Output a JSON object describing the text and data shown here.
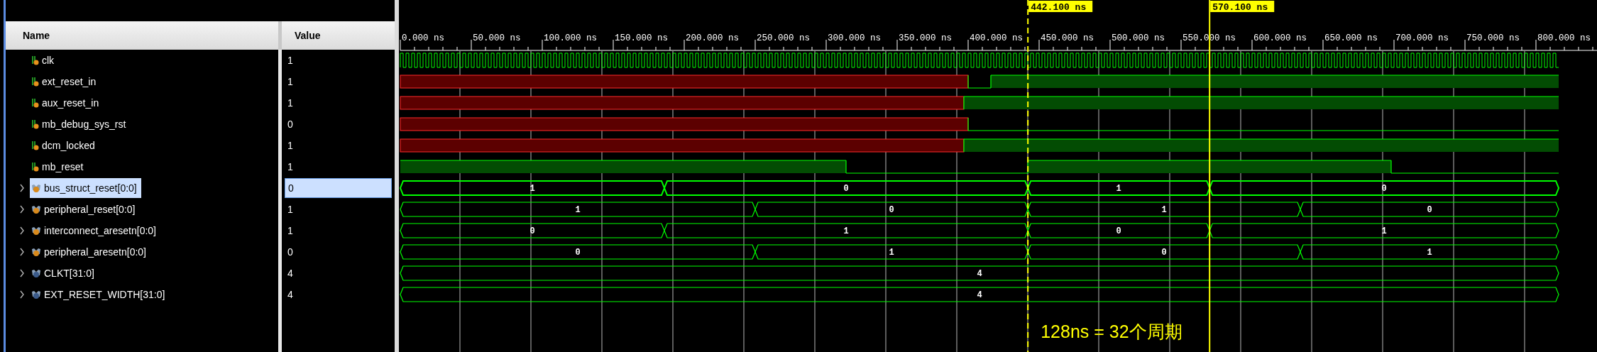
{
  "name_panel": {
    "headers": {
      "name": "Name",
      "value": "Value"
    },
    "signals": [
      {
        "name": "clk",
        "value": "1",
        "kind": "clock",
        "selected": false
      },
      {
        "name": "ext_reset_in",
        "value": "1",
        "kind": "bit",
        "selected": false
      },
      {
        "name": "aux_reset_in",
        "value": "1",
        "kind": "bit",
        "selected": false
      },
      {
        "name": "mb_debug_sys_rst",
        "value": "0",
        "kind": "bit",
        "selected": false
      },
      {
        "name": "dcm_locked",
        "value": "1",
        "kind": "bit",
        "selected": false
      },
      {
        "name": "mb_reset",
        "value": "1",
        "kind": "bit",
        "selected": false
      },
      {
        "name": "bus_struct_reset[0:0]",
        "value": "0",
        "kind": "bus",
        "selected": true,
        "wave_labels": [
          "1",
          "0",
          "1",
          "0"
        ]
      },
      {
        "name": "peripheral_reset[0:0]",
        "value": "1",
        "kind": "bus",
        "selected": false,
        "wave_labels": [
          "1",
          "0",
          "1",
          "0"
        ]
      },
      {
        "name": "interconnect_aresetn[0:0]",
        "value": "1",
        "kind": "bus",
        "selected": false,
        "wave_labels": [
          "0",
          "1",
          "0",
          "1"
        ]
      },
      {
        "name": "peripheral_aresetn[0:0]",
        "value": "0",
        "kind": "bus",
        "selected": false,
        "wave_labels": [
          "0",
          "1",
          "0",
          "1"
        ]
      },
      {
        "name": "CLKT[31:0]",
        "value": "4",
        "kind": "constant",
        "selected": false,
        "wave_labels": [
          "4"
        ]
      },
      {
        "name": "EXT_RESET_WIDTH[31:0]",
        "value": "4",
        "kind": "constant",
        "selected": false,
        "wave_labels": [
          "4"
        ]
      }
    ]
  },
  "ruler": {
    "labels": [
      "0.000 ns",
      "50.000 ns",
      "100.000 ns",
      "150.000 ns",
      "200.000 ns",
      "250.000 ns",
      "300.000 ns",
      "350.000 ns",
      "400.000 ns",
      "450.000 ns",
      "500.000 ns",
      "550.000 ns",
      "600.000 ns",
      "650.000 ns",
      "700.000 ns",
      "750.000 ns",
      "800.000 ns"
    ]
  },
  "cursors": [
    {
      "label": "442.100 ns",
      "kind": "marker"
    },
    {
      "label": "570.100 ns",
      "kind": "cursor"
    }
  ],
  "annotation": "128ns = 32个周期"
}
